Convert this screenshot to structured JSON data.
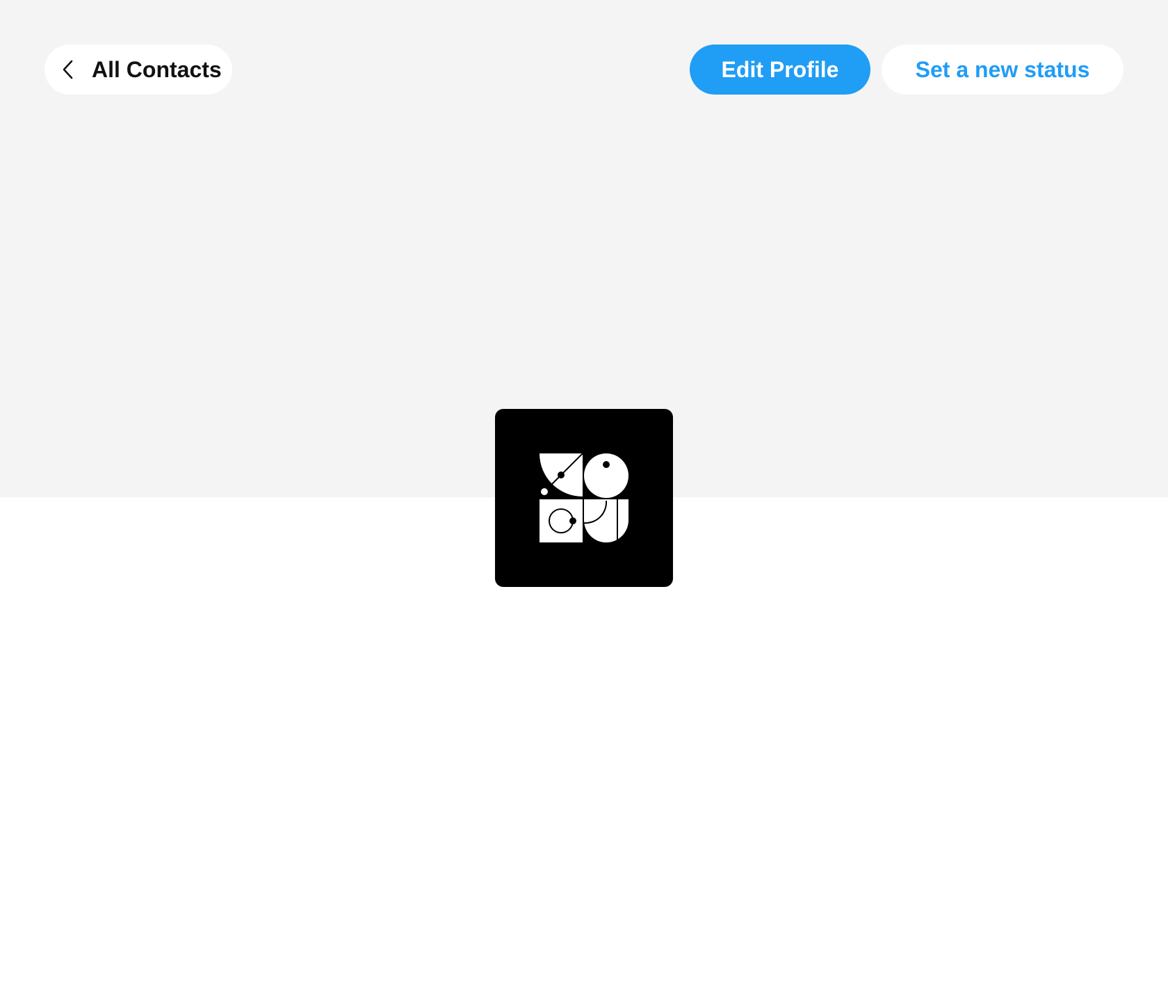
{
  "header": {
    "back_label": "All Contacts",
    "edit_label": "Edit Profile",
    "status_label": "Set a new status"
  },
  "icons": {
    "back": "chevron-left-icon",
    "avatar": "geometric-avatar-logo"
  },
  "colors": {
    "accent": "#209df5",
    "cover": "#f4f4f4",
    "background": "#ffffff",
    "avatar_bg": "#000000"
  }
}
